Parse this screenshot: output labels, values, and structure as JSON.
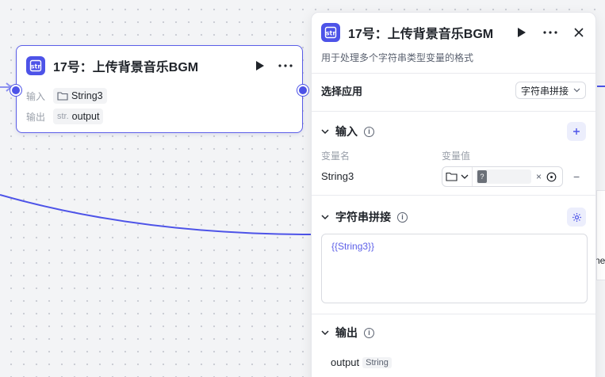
{
  "node": {
    "title": "17号：上传背景音乐BGM",
    "input_label": "输入",
    "input_value": "String3",
    "output_label": "输出",
    "output_type_prefix": "str.",
    "output_value": "output"
  },
  "panel": {
    "title": "17号：上传背景音乐BGM",
    "subtitle": "用于处理多个字符串类型变量的格式",
    "select_app_label": "选择应用",
    "select_app_value": "字符串拼接",
    "input_section": {
      "title": "输入",
      "col_name": "变量名",
      "col_value": "变量值",
      "rows": [
        {
          "name": "String3"
        }
      ]
    },
    "concat_section": {
      "title": "字符串拼接",
      "template": "{{String3}}"
    },
    "output_section": {
      "title": "输出",
      "name": "output",
      "type": "String"
    }
  },
  "peek_text": "ne",
  "colors": {
    "accent": "#4d53e8",
    "canvas": "#f3f4f6"
  }
}
